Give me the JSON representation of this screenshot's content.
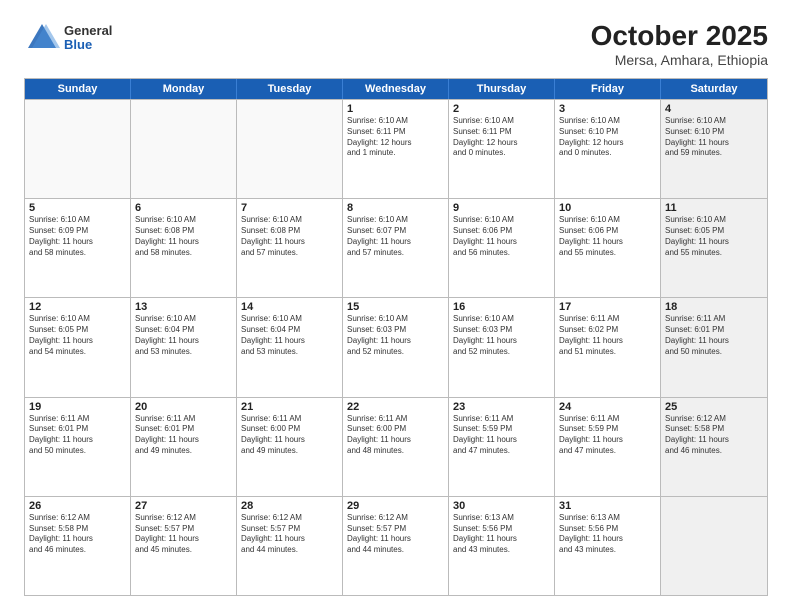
{
  "logo": {
    "general": "General",
    "blue": "Blue"
  },
  "title": "October 2025",
  "subtitle": "Mersa, Amhara, Ethiopia",
  "weekdays": [
    "Sunday",
    "Monday",
    "Tuesday",
    "Wednesday",
    "Thursday",
    "Friday",
    "Saturday"
  ],
  "weeks": [
    [
      {
        "day": "",
        "empty": true
      },
      {
        "day": "",
        "empty": true
      },
      {
        "day": "",
        "empty": true
      },
      {
        "day": "1",
        "lines": [
          "Sunrise: 6:10 AM",
          "Sunset: 6:11 PM",
          "Daylight: 12 hours",
          "and 1 minute."
        ]
      },
      {
        "day": "2",
        "lines": [
          "Sunrise: 6:10 AM",
          "Sunset: 6:11 PM",
          "Daylight: 12 hours",
          "and 0 minutes."
        ]
      },
      {
        "day": "3",
        "lines": [
          "Sunrise: 6:10 AM",
          "Sunset: 6:10 PM",
          "Daylight: 12 hours",
          "and 0 minutes."
        ]
      },
      {
        "day": "4",
        "lines": [
          "Sunrise: 6:10 AM",
          "Sunset: 6:10 PM",
          "Daylight: 11 hours",
          "and 59 minutes."
        ],
        "shaded": true
      }
    ],
    [
      {
        "day": "5",
        "lines": [
          "Sunrise: 6:10 AM",
          "Sunset: 6:09 PM",
          "Daylight: 11 hours",
          "and 58 minutes."
        ]
      },
      {
        "day": "6",
        "lines": [
          "Sunrise: 6:10 AM",
          "Sunset: 6:08 PM",
          "Daylight: 11 hours",
          "and 58 minutes."
        ]
      },
      {
        "day": "7",
        "lines": [
          "Sunrise: 6:10 AM",
          "Sunset: 6:08 PM",
          "Daylight: 11 hours",
          "and 57 minutes."
        ]
      },
      {
        "day": "8",
        "lines": [
          "Sunrise: 6:10 AM",
          "Sunset: 6:07 PM",
          "Daylight: 11 hours",
          "and 57 minutes."
        ]
      },
      {
        "day": "9",
        "lines": [
          "Sunrise: 6:10 AM",
          "Sunset: 6:06 PM",
          "Daylight: 11 hours",
          "and 56 minutes."
        ]
      },
      {
        "day": "10",
        "lines": [
          "Sunrise: 6:10 AM",
          "Sunset: 6:06 PM",
          "Daylight: 11 hours",
          "and 55 minutes."
        ]
      },
      {
        "day": "11",
        "lines": [
          "Sunrise: 6:10 AM",
          "Sunset: 6:05 PM",
          "Daylight: 11 hours",
          "and 55 minutes."
        ],
        "shaded": true
      }
    ],
    [
      {
        "day": "12",
        "lines": [
          "Sunrise: 6:10 AM",
          "Sunset: 6:05 PM",
          "Daylight: 11 hours",
          "and 54 minutes."
        ]
      },
      {
        "day": "13",
        "lines": [
          "Sunrise: 6:10 AM",
          "Sunset: 6:04 PM",
          "Daylight: 11 hours",
          "and 53 minutes."
        ]
      },
      {
        "day": "14",
        "lines": [
          "Sunrise: 6:10 AM",
          "Sunset: 6:04 PM",
          "Daylight: 11 hours",
          "and 53 minutes."
        ]
      },
      {
        "day": "15",
        "lines": [
          "Sunrise: 6:10 AM",
          "Sunset: 6:03 PM",
          "Daylight: 11 hours",
          "and 52 minutes."
        ]
      },
      {
        "day": "16",
        "lines": [
          "Sunrise: 6:10 AM",
          "Sunset: 6:03 PM",
          "Daylight: 11 hours",
          "and 52 minutes."
        ]
      },
      {
        "day": "17",
        "lines": [
          "Sunrise: 6:11 AM",
          "Sunset: 6:02 PM",
          "Daylight: 11 hours",
          "and 51 minutes."
        ]
      },
      {
        "day": "18",
        "lines": [
          "Sunrise: 6:11 AM",
          "Sunset: 6:01 PM",
          "Daylight: 11 hours",
          "and 50 minutes."
        ],
        "shaded": true
      }
    ],
    [
      {
        "day": "19",
        "lines": [
          "Sunrise: 6:11 AM",
          "Sunset: 6:01 PM",
          "Daylight: 11 hours",
          "and 50 minutes."
        ]
      },
      {
        "day": "20",
        "lines": [
          "Sunrise: 6:11 AM",
          "Sunset: 6:01 PM",
          "Daylight: 11 hours",
          "and 49 minutes."
        ]
      },
      {
        "day": "21",
        "lines": [
          "Sunrise: 6:11 AM",
          "Sunset: 6:00 PM",
          "Daylight: 11 hours",
          "and 49 minutes."
        ]
      },
      {
        "day": "22",
        "lines": [
          "Sunrise: 6:11 AM",
          "Sunset: 6:00 PM",
          "Daylight: 11 hours",
          "and 48 minutes."
        ]
      },
      {
        "day": "23",
        "lines": [
          "Sunrise: 6:11 AM",
          "Sunset: 5:59 PM",
          "Daylight: 11 hours",
          "and 47 minutes."
        ]
      },
      {
        "day": "24",
        "lines": [
          "Sunrise: 6:11 AM",
          "Sunset: 5:59 PM",
          "Daylight: 11 hours",
          "and 47 minutes."
        ]
      },
      {
        "day": "25",
        "lines": [
          "Sunrise: 6:12 AM",
          "Sunset: 5:58 PM",
          "Daylight: 11 hours",
          "and 46 minutes."
        ],
        "shaded": true
      }
    ],
    [
      {
        "day": "26",
        "lines": [
          "Sunrise: 6:12 AM",
          "Sunset: 5:58 PM",
          "Daylight: 11 hours",
          "and 46 minutes."
        ]
      },
      {
        "day": "27",
        "lines": [
          "Sunrise: 6:12 AM",
          "Sunset: 5:57 PM",
          "Daylight: 11 hours",
          "and 45 minutes."
        ]
      },
      {
        "day": "28",
        "lines": [
          "Sunrise: 6:12 AM",
          "Sunset: 5:57 PM",
          "Daylight: 11 hours",
          "and 44 minutes."
        ]
      },
      {
        "day": "29",
        "lines": [
          "Sunrise: 6:12 AM",
          "Sunset: 5:57 PM",
          "Daylight: 11 hours",
          "and 44 minutes."
        ]
      },
      {
        "day": "30",
        "lines": [
          "Sunrise: 6:13 AM",
          "Sunset: 5:56 PM",
          "Daylight: 11 hours",
          "and 43 minutes."
        ]
      },
      {
        "day": "31",
        "lines": [
          "Sunrise: 6:13 AM",
          "Sunset: 5:56 PM",
          "Daylight: 11 hours",
          "and 43 minutes."
        ]
      },
      {
        "day": "",
        "empty": true,
        "shaded": true
      }
    ]
  ]
}
